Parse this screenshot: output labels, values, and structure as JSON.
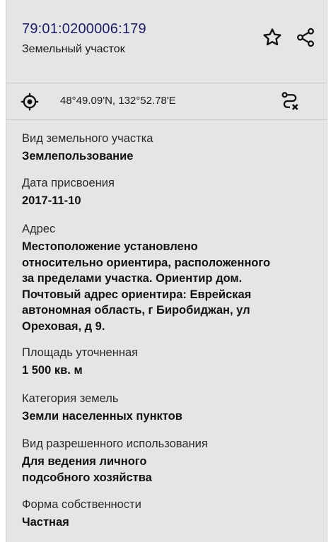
{
  "header": {
    "cadastral_number": "79:01:0200006:179",
    "object_type": "Земельный участок",
    "star_icon": "star-outline-icon",
    "share_icon": "share-icon"
  },
  "coordinates": {
    "text": "48°49.09'N, 132°52.78'E",
    "target_icon": "crosshair-icon",
    "route_icon": "route-cancel-icon"
  },
  "fields": [
    {
      "label": "Вид земельного участка",
      "value": "Землепользование"
    },
    {
      "label": "Дата присвоения",
      "value": "2017-11-10"
    },
    {
      "label": "Адрес",
      "value_lines": [
        "Местоположение установлено",
        "относительно ориентира, расположенного",
        "за пределами участка. Ориентир дом.",
        "Почтовый адрес ориентира: Еврейская",
        "автономная область, г Биробиджан, ул",
        "Ореховая, д 9."
      ]
    },
    {
      "label": "Площадь уточненная",
      "value": "1 500 кв. м"
    },
    {
      "label": "Категория земель",
      "value": "Земли населенных пунктов"
    },
    {
      "label": "Вид разрешенного использования",
      "value_lines": [
        "Для ведения личного",
        "подсобного хозяйства"
      ]
    },
    {
      "label": "Форма собственности",
      "value": "Частная"
    }
  ],
  "colors": {
    "background": "#e5e5e5",
    "cadastral_number": "#1c1c6b",
    "divider": "#c7c7c7"
  }
}
